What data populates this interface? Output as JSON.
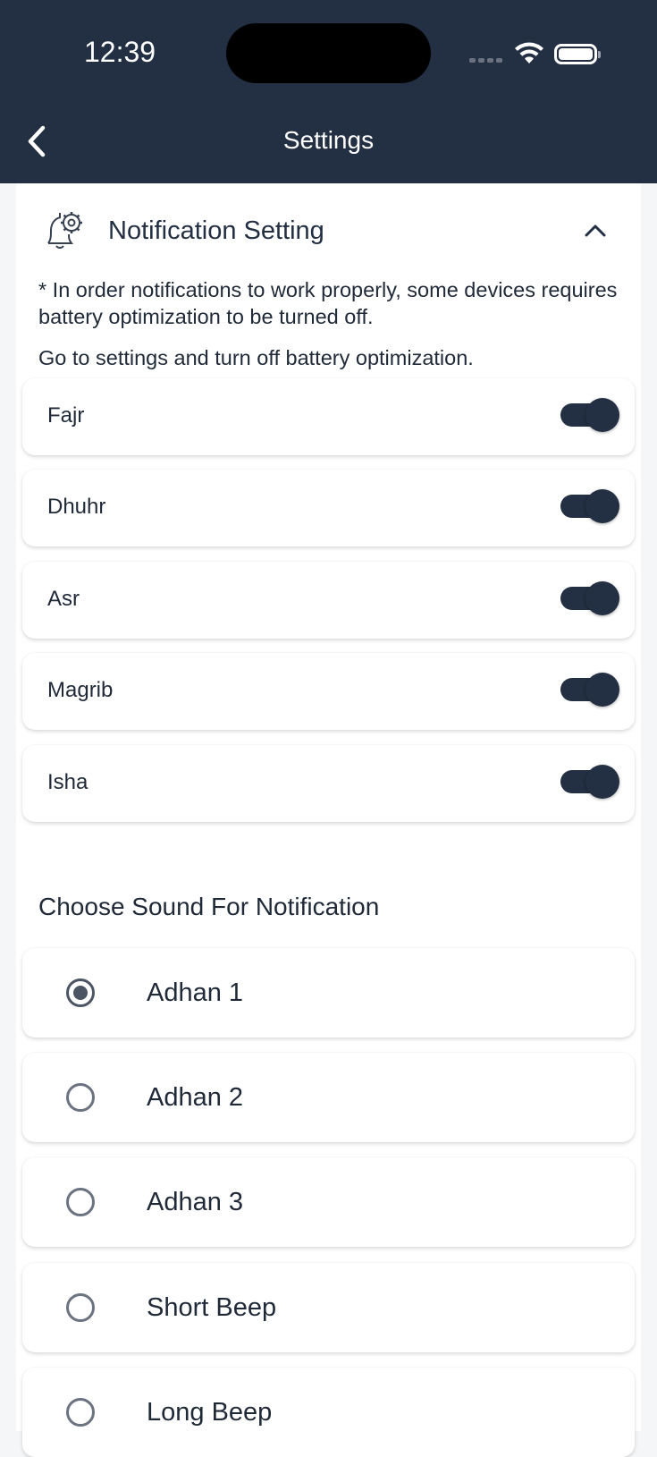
{
  "status_bar": {
    "time": "12:39"
  },
  "header": {
    "title": "Settings",
    "back_icon": "chevron-left-icon"
  },
  "notification_section": {
    "icon": "bell-gear-icon",
    "title": "Notification Setting",
    "expanded": true,
    "note": "* In order notifications to work properly, some devices requires battery optimization to be turned off.",
    "instruction": "Go to settings and turn off battery optimization.",
    "prayers": [
      {
        "label": "Fajr",
        "enabled": true
      },
      {
        "label": "Dhuhr",
        "enabled": true
      },
      {
        "label": "Asr",
        "enabled": true
      },
      {
        "label": "Magrib",
        "enabled": true
      },
      {
        "label": "Isha",
        "enabled": true
      }
    ]
  },
  "sound_section": {
    "heading": "Choose Sound For Notification",
    "selected": "Adhan 1",
    "options": [
      {
        "label": "Adhan 1",
        "selected": true
      },
      {
        "label": "Adhan 2",
        "selected": false
      },
      {
        "label": "Adhan 3",
        "selected": false
      },
      {
        "label": "Short Beep",
        "selected": false
      },
      {
        "label": "Long Beep",
        "selected": false
      }
    ]
  },
  "colors": {
    "header_bg": "#232f42",
    "accent": "#232f42",
    "page_bg": "#f5f6f8"
  }
}
